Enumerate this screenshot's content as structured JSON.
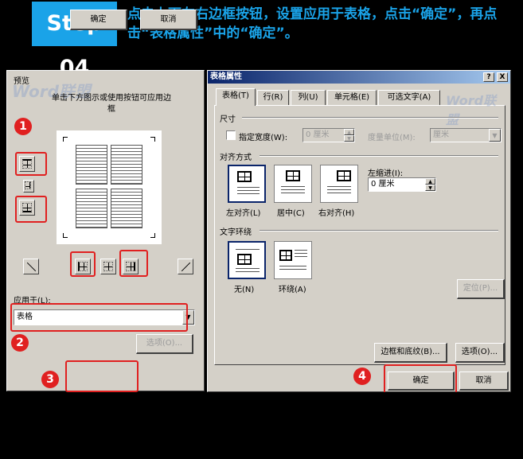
{
  "banner": {
    "step": "Step 04",
    "instruction": "点击上下左右边框按钮，设置应用于表格，点击“确定”，再点击“表格属性”中的“确定”。"
  },
  "watermark": "Word联盟",
  "left_dialog": {
    "preview_title": "预览",
    "preview_hint": "单击下方图示或使用按钮可应用边框",
    "apply_to_label": "应用于(L):",
    "apply_to_value": "表格",
    "options_button": "选项(O)...",
    "ok_button": "确定",
    "cancel_button": "取消"
  },
  "right_dialog": {
    "title": "表格属性",
    "title_buttons": [
      "?",
      "X"
    ],
    "tabs": [
      {
        "label": "表格(T)",
        "active": true
      },
      {
        "label": "行(R)",
        "active": false
      },
      {
        "label": "列(U)",
        "active": false
      },
      {
        "label": "单元格(E)",
        "active": false
      },
      {
        "label": "可选文字(A)",
        "active": false
      }
    ],
    "size_section": "尺寸",
    "preferred_width_label": "指定宽度(W):",
    "preferred_width_value": "0 厘米",
    "measure_label": "度量单位(M):",
    "measure_value": "厘米",
    "alignment_section": "对齐方式",
    "alignment_options": [
      "左对齐(L)",
      "居中(C)",
      "右对齐(H)"
    ],
    "indent_label": "左缩进(I):",
    "indent_value": "0 厘米",
    "wrap_section": "文字环绕",
    "wrap_options": [
      "无(N)",
      "环绕(A)"
    ],
    "position_button": "定位(P)...",
    "borders_button": "边框和底纹(B)...",
    "options_button": "选项(O)...",
    "ok_button": "确定",
    "cancel_button": "取消"
  },
  "callouts": [
    "1",
    "2",
    "3",
    "4"
  ],
  "colors": {
    "accent_blue": "#1aa3e8",
    "callout_red": "#e02020",
    "dialog_gray": "#d4d0c8",
    "title_blue": "#0a246a"
  }
}
